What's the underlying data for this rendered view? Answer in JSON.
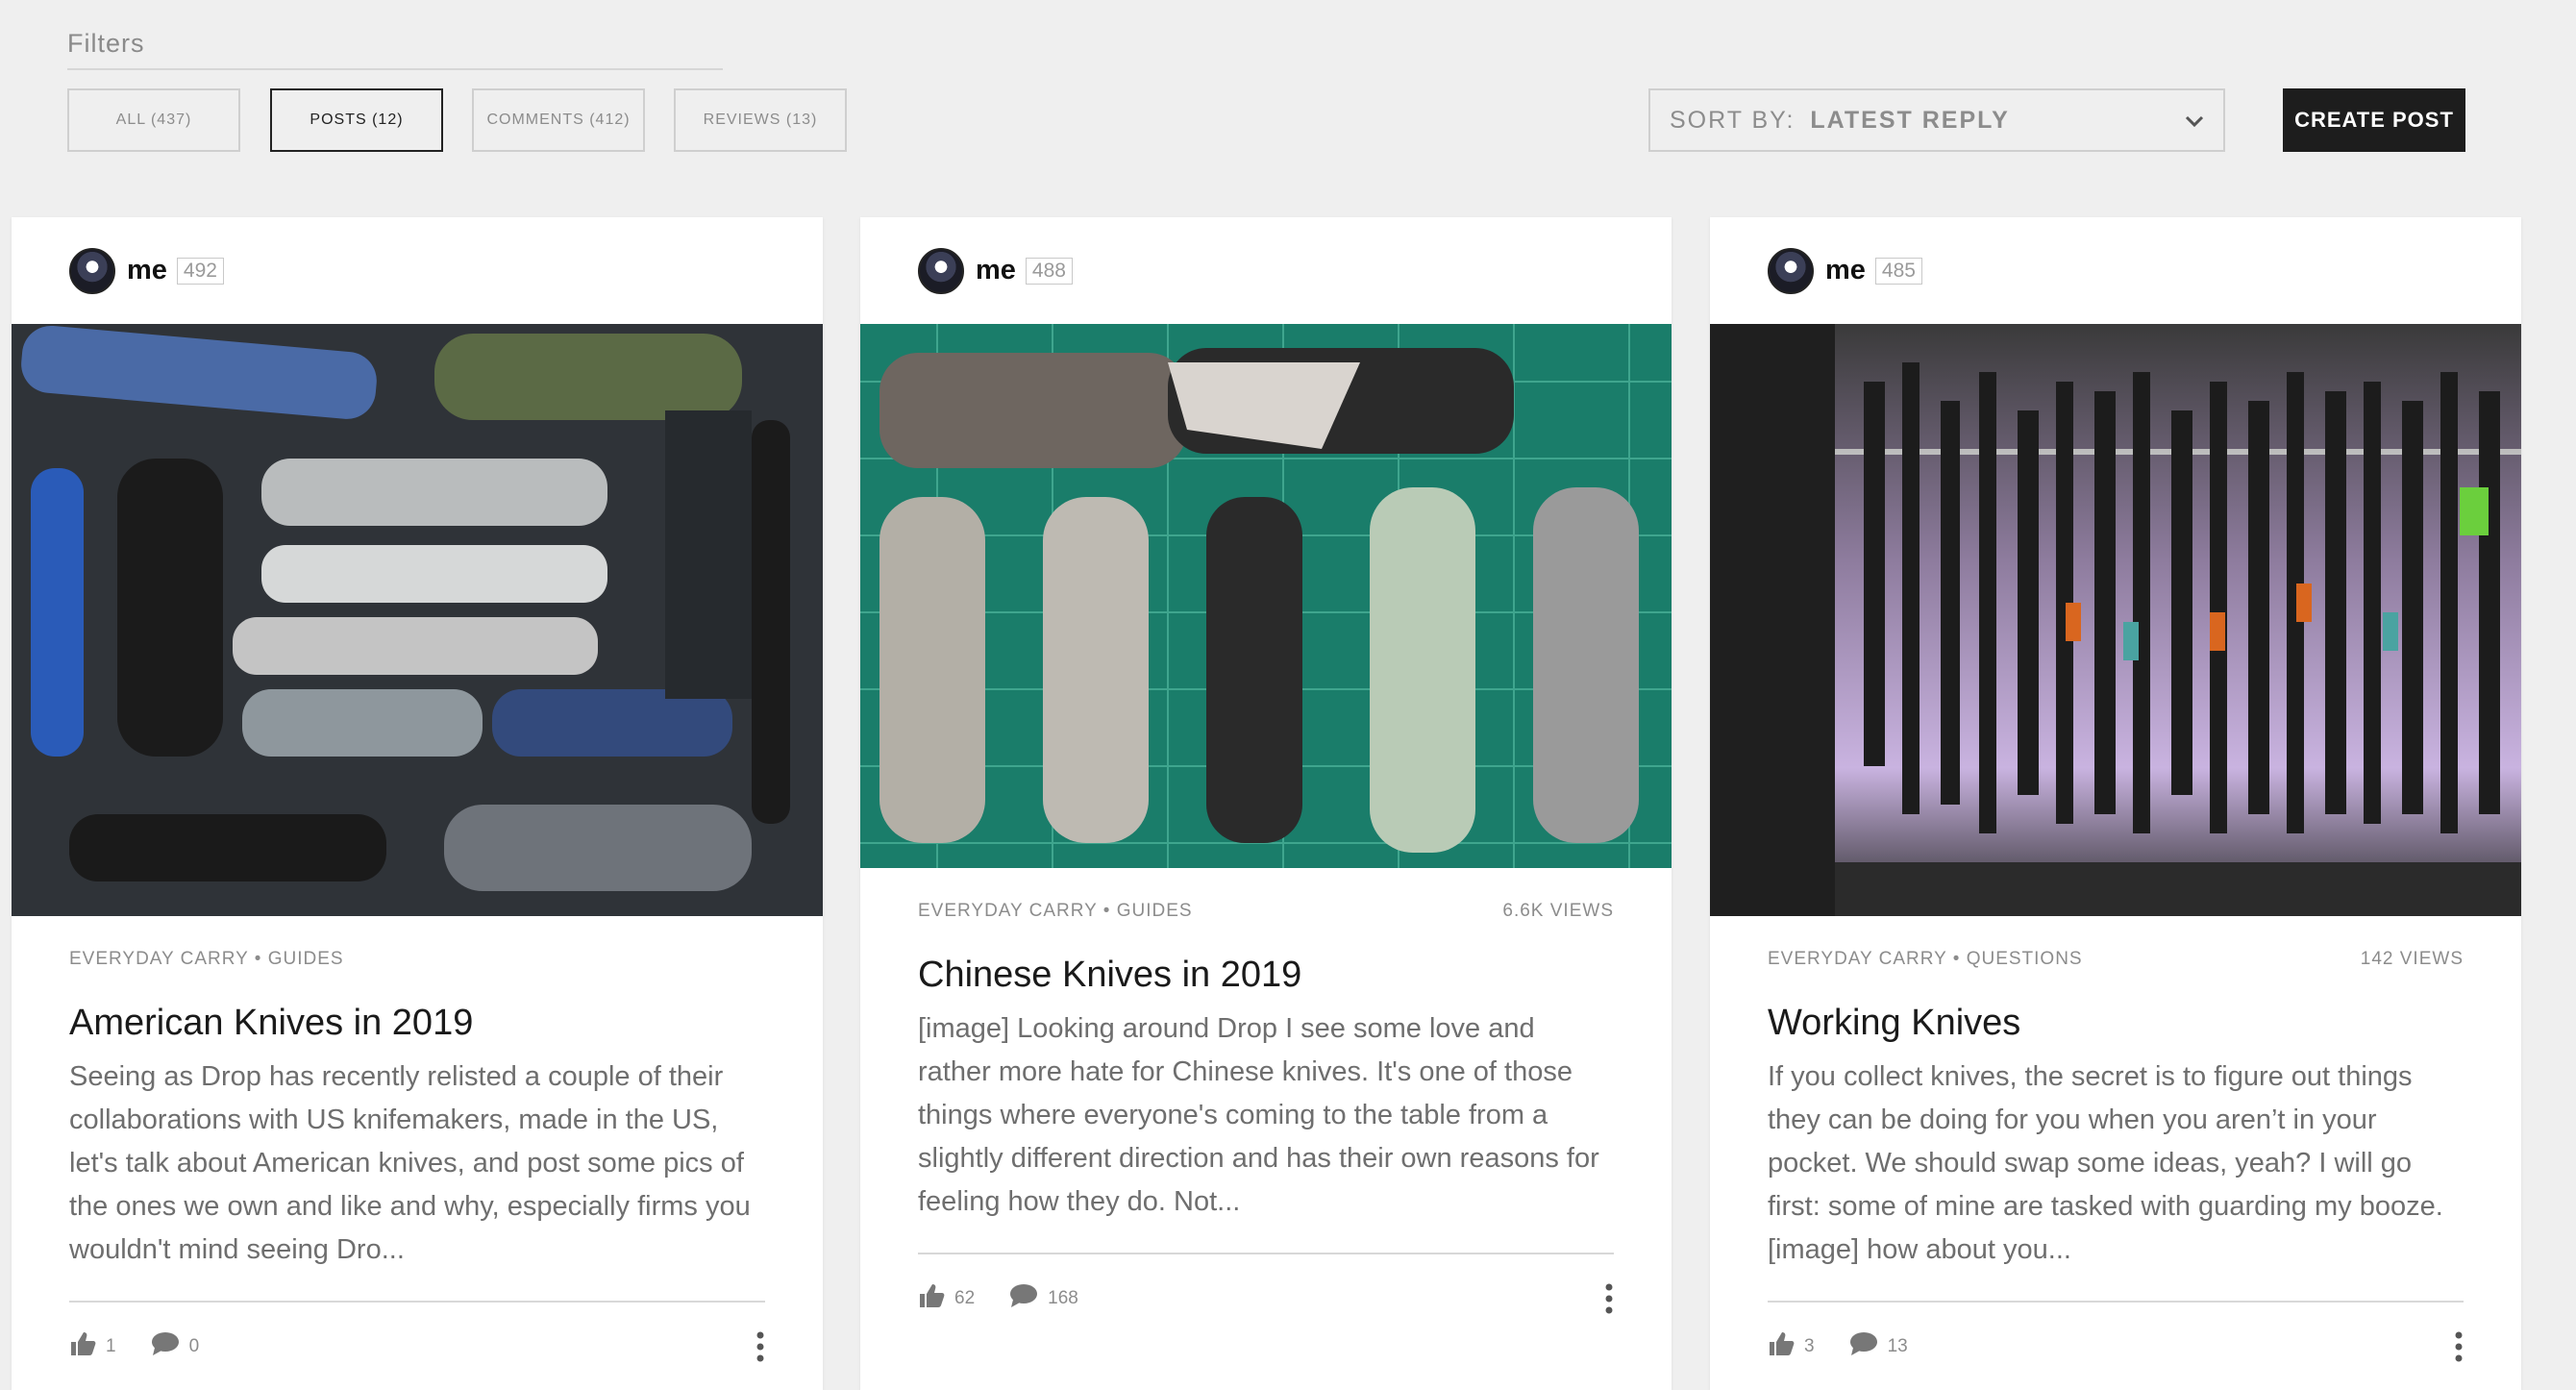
{
  "filters": {
    "title": "Filters",
    "buttons": [
      {
        "label": "ALL (437)",
        "active": false
      },
      {
        "label": "POSTS (12)",
        "active": true
      },
      {
        "label": "COMMENTS (412)",
        "active": false
      },
      {
        "label": "REVIEWS (13)",
        "active": false
      }
    ]
  },
  "sort": {
    "label": "SORT BY:",
    "value": "LATEST REPLY"
  },
  "create_post": "CREATE POST",
  "cards": [
    {
      "user": "me",
      "score": "492",
      "category": "EVERYDAY CARRY • GUIDES",
      "views": "",
      "title": "American Knives in 2019",
      "body": "Seeing as Drop has recently relisted a couple of their collaborations with US knifemakers, made in the US, let's talk about American knives, and post some pics of the ones we own and like and why, especially firms you wouldn't mind seeing Dro...",
      "likes": "1",
      "comments": "0"
    },
    {
      "user": "me",
      "score": "488",
      "category": "EVERYDAY CARRY • GUIDES",
      "views": "6.6K VIEWS",
      "title": "Chinese Knives in 2019",
      "body": "[image] Looking around Drop I see some love and rather more hate for Chinese knives. It's one of those things where everyone's coming to the table from a slightly different direction and has their own reasons for feeling how they do. Not...",
      "likes": "62",
      "comments": "168"
    },
    {
      "user": "me",
      "score": "485",
      "category": "EVERYDAY CARRY • QUESTIONS",
      "views": "142 VIEWS",
      "title": "Working Knives",
      "body": "If you collect knives, the secret is to figure out things they can be doing for you when you aren’t in your pocket. We should swap some ideas, yeah? I will go first: some of mine are tasked with guarding my booze. [image] how about you...",
      "likes": "3",
      "comments": "13"
    }
  ],
  "icons": {
    "like": "thumbs-up-icon",
    "comment": "comment-bubble-icon",
    "more": "more-vertical-icon",
    "sort": "chevron-down-icon"
  }
}
